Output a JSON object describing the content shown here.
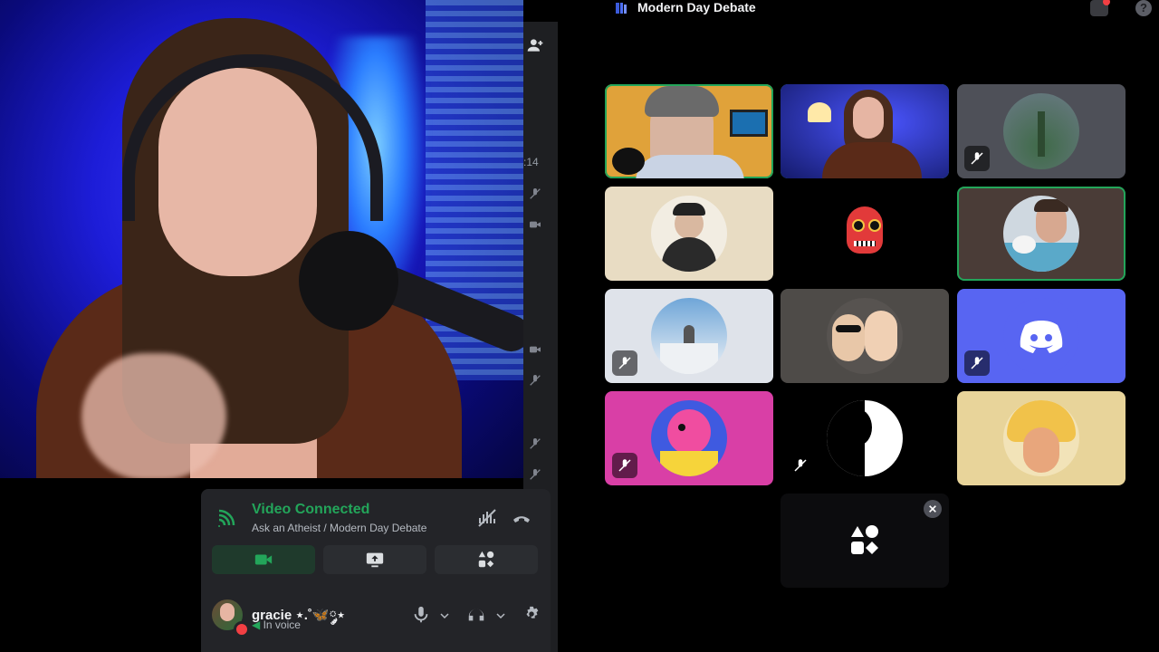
{
  "window": {
    "title": "Modern Day Debate"
  },
  "sidebar": {
    "time_fragment": ":14"
  },
  "voice_panel": {
    "status": "Video Connected",
    "channel": "Ask an Atheist / Modern Day Debate",
    "actions": [
      "camera",
      "screen-share",
      "activities"
    ]
  },
  "user": {
    "name": "gracie ⋆.˚🦋༘⋆",
    "status_text": "In voice"
  },
  "tiles": [
    {
      "id": "tile-1",
      "type": "video",
      "speaking": true,
      "muted": false
    },
    {
      "id": "tile-2",
      "type": "video",
      "speaking": true,
      "muted": false
    },
    {
      "id": "tile-3",
      "type": "avatar",
      "speaking": false,
      "muted": true
    },
    {
      "id": "tile-4",
      "type": "avatar",
      "speaking": false,
      "muted": false
    },
    {
      "id": "tile-5",
      "type": "avatar",
      "speaking": false,
      "muted": false
    },
    {
      "id": "tile-6",
      "type": "avatar",
      "speaking": true,
      "muted": false
    },
    {
      "id": "tile-7",
      "type": "avatar",
      "speaking": false,
      "muted": true
    },
    {
      "id": "tile-8",
      "type": "avatar",
      "speaking": false,
      "muted": false
    },
    {
      "id": "tile-9",
      "type": "avatar",
      "speaking": false,
      "muted": true
    },
    {
      "id": "tile-10",
      "type": "avatar",
      "speaking": false,
      "muted": true
    },
    {
      "id": "tile-11",
      "type": "avatar",
      "speaking": false,
      "muted": true
    },
    {
      "id": "tile-12",
      "type": "avatar",
      "speaking": false,
      "muted": false
    }
  ],
  "colors": {
    "green": "#23a55a",
    "blurple": "#5865f2",
    "panel": "#232428"
  }
}
